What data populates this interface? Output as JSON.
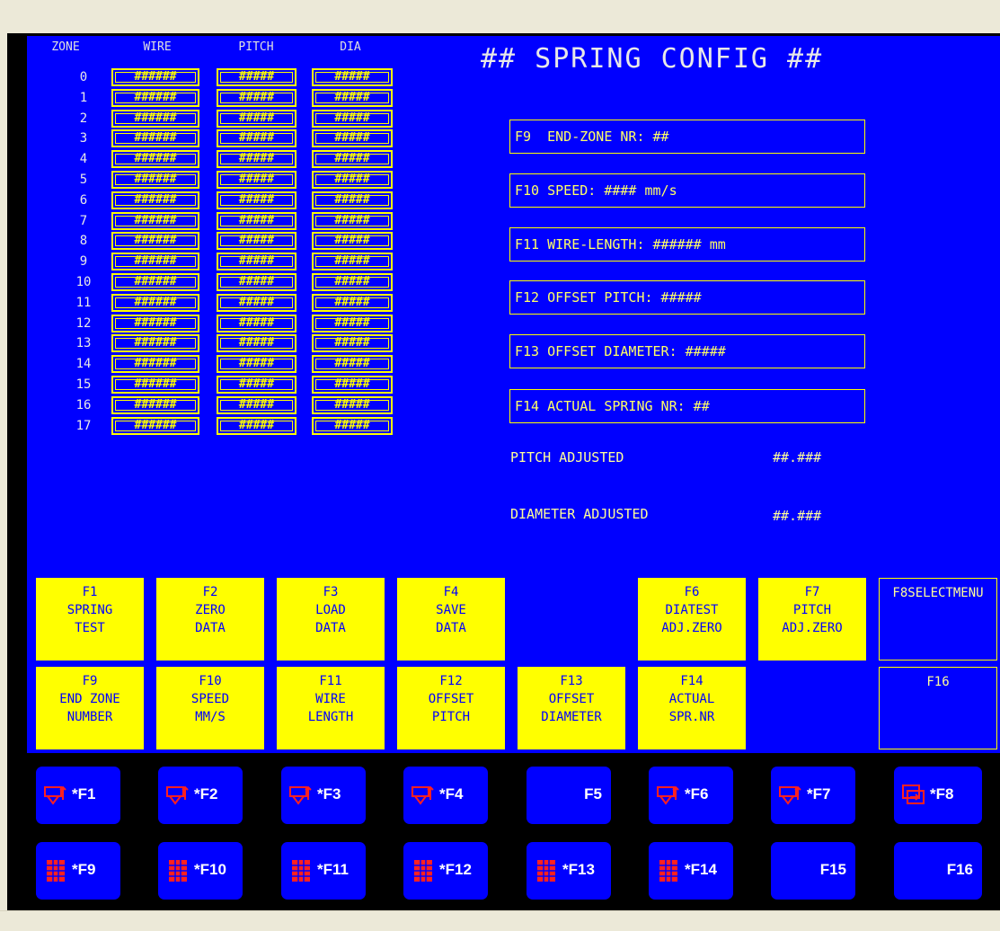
{
  "table": {
    "headers": [
      "ZONE",
      "WIRE",
      "PITCH",
      "DIA"
    ],
    "rows": [
      {
        "zone": "0",
        "wire": "######",
        "pitch": "#####",
        "dia": "#####"
      },
      {
        "zone": "1",
        "wire": "######",
        "pitch": "#####",
        "dia": "#####"
      },
      {
        "zone": "2",
        "wire": "######",
        "pitch": "#####",
        "dia": "#####"
      },
      {
        "zone": "3",
        "wire": "######",
        "pitch": "#####",
        "dia": "#####"
      },
      {
        "zone": "4",
        "wire": "######",
        "pitch": "#####",
        "dia": "#####"
      },
      {
        "zone": "5",
        "wire": "######",
        "pitch": "#####",
        "dia": "#####"
      },
      {
        "zone": "6",
        "wire": "######",
        "pitch": "#####",
        "dia": "#####"
      },
      {
        "zone": "7",
        "wire": "######",
        "pitch": "#####",
        "dia": "#####"
      },
      {
        "zone": "8",
        "wire": "######",
        "pitch": "#####",
        "dia": "#####"
      },
      {
        "zone": "9",
        "wire": "######",
        "pitch": "#####",
        "dia": "#####"
      },
      {
        "zone": "10",
        "wire": "######",
        "pitch": "#####",
        "dia": "#####"
      },
      {
        "zone": "11",
        "wire": "######",
        "pitch": "#####",
        "dia": "#####"
      },
      {
        "zone": "12",
        "wire": "######",
        "pitch": "#####",
        "dia": "#####"
      },
      {
        "zone": "13",
        "wire": "######",
        "pitch": "#####",
        "dia": "#####"
      },
      {
        "zone": "14",
        "wire": "######",
        "pitch": "#####",
        "dia": "#####"
      },
      {
        "zone": "15",
        "wire": "######",
        "pitch": "#####",
        "dia": "#####"
      },
      {
        "zone": "16",
        "wire": "######",
        "pitch": "#####",
        "dia": "#####"
      },
      {
        "zone": "17",
        "wire": "######",
        "pitch": "#####",
        "dia": "#####"
      }
    ]
  },
  "config": {
    "title": "## SPRING CONFIG ##",
    "fields": [
      "F9  END-ZONE NR: ##",
      "F10 SPEED: #### mm/s",
      "F11 WIRE-LENGTH: ###### mm",
      "F12 OFFSET PITCH: #####",
      "F13 OFFSET DIAMETER: #####",
      "F14 ACTUAL SPRING NR: ##"
    ],
    "pitch_adjusted_label": "PITCH ADJUSTED",
    "pitch_adjusted_value": "##.###",
    "diameter_adjusted_label": "DIAMETER ADJUSTED",
    "diameter_adjusted_value": "##.###"
  },
  "fkeys_row1": [
    {
      "lines": [
        "F1",
        "SPRING",
        "TEST"
      ],
      "style": "yellow"
    },
    {
      "lines": [
        "F2",
        "ZERO",
        "DATA"
      ],
      "style": "yellow"
    },
    {
      "lines": [
        "F3",
        "LOAD",
        "DATA"
      ],
      "style": "yellow"
    },
    {
      "lines": [
        "F4",
        "SAVE",
        "DATA"
      ],
      "style": "yellow"
    },
    {
      "lines": [],
      "style": "none"
    },
    {
      "lines": [
        "F6",
        "DIATEST",
        "ADJ.ZERO"
      ],
      "style": "yellow"
    },
    {
      "lines": [
        "F7",
        "PITCH",
        "ADJ.ZERO"
      ],
      "style": "yellow"
    },
    {
      "lines": [
        "F8",
        "SELECT",
        "MENU"
      ],
      "style": "outline"
    }
  ],
  "fkeys_row2": [
    {
      "lines": [
        "F9",
        "END ZONE",
        "NUMBER"
      ],
      "style": "yellow"
    },
    {
      "lines": [
        "F10",
        "SPEED",
        "MM/S"
      ],
      "style": "yellow"
    },
    {
      "lines": [
        "F11",
        "WIRE",
        "LENGTH"
      ],
      "style": "yellow"
    },
    {
      "lines": [
        "F12",
        "OFFSET",
        "PITCH"
      ],
      "style": "yellow"
    },
    {
      "lines": [
        "F13",
        "OFFSET",
        "DIAMETER"
      ],
      "style": "yellow"
    },
    {
      "lines": [
        "F14",
        "ACTUAL",
        "SPR.NR"
      ],
      "style": "yellow"
    },
    {
      "lines": [],
      "style": "none"
    },
    {
      "lines": [
        "F16"
      ],
      "style": "outline"
    }
  ],
  "hardkeys_row1": [
    {
      "label": "*F1",
      "icon": "arrow-icon"
    },
    {
      "label": "*F2",
      "icon": "arrow-icon"
    },
    {
      "label": "*F3",
      "icon": "arrow-icon"
    },
    {
      "label": "*F4",
      "icon": "arrow-icon"
    },
    {
      "label": "F5",
      "icon": ""
    },
    {
      "label": "*F6",
      "icon": "arrow-icon"
    },
    {
      "label": "*F7",
      "icon": "arrow-icon"
    },
    {
      "label": "*F8",
      "icon": "windows-icon"
    }
  ],
  "hardkeys_row2": [
    {
      "label": "*F9",
      "icon": "grid-icon"
    },
    {
      "label": "*F10",
      "icon": "grid-icon"
    },
    {
      "label": "*F11",
      "icon": "grid-icon"
    },
    {
      "label": "*F12",
      "icon": "grid-icon"
    },
    {
      "label": "*F13",
      "icon": "grid-icon"
    },
    {
      "label": "*F14",
      "icon": "grid-icon"
    },
    {
      "label": "F15",
      "icon": ""
    },
    {
      "label": "F16",
      "icon": ""
    }
  ],
  "colors": {
    "panel": "#0000ff",
    "accent": "#ffff00",
    "icon": "#ff2020"
  }
}
